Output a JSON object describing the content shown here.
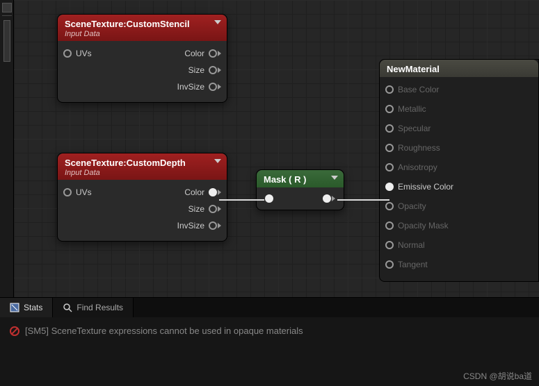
{
  "nodes": {
    "stencil": {
      "title": "SceneTexture:CustomStencil",
      "subtitle": "Input Data",
      "inputs": {
        "uvs": "UVs"
      },
      "outputs": {
        "color": "Color",
        "size": "Size",
        "invsize": "InvSize"
      }
    },
    "depth": {
      "title": "SceneTexture:CustomDepth",
      "subtitle": "Input Data",
      "inputs": {
        "uvs": "UVs"
      },
      "outputs": {
        "color": "Color",
        "size": "Size",
        "invsize": "InvSize"
      }
    },
    "mask": {
      "title": "Mask ( R )"
    },
    "material": {
      "title": "NewMaterial",
      "pins": [
        {
          "label": "Base Color",
          "active": false
        },
        {
          "label": "Metallic",
          "active": false
        },
        {
          "label": "Specular",
          "active": false
        },
        {
          "label": "Roughness",
          "active": false
        },
        {
          "label": "Anisotropy",
          "active": false
        },
        {
          "label": "Emissive Color",
          "active": true
        },
        {
          "label": "Opacity",
          "active": false
        },
        {
          "label": "Opacity Mask",
          "active": false
        },
        {
          "label": "Normal",
          "active": false
        },
        {
          "label": "Tangent",
          "active": false
        }
      ]
    }
  },
  "tabs": {
    "stats": "Stats",
    "find": "Find Results"
  },
  "log": {
    "message": "[SM5] SceneTexture expressions cannot be used in opaque materials"
  },
  "watermark": "CSDN @胡说ba道"
}
